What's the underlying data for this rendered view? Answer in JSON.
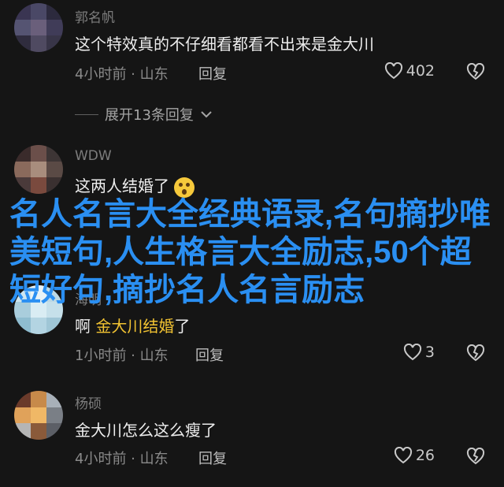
{
  "comments": [
    {
      "username": "郭名帆",
      "text": "这个特效真的不仔细看都看不出来是金大川",
      "time_location": "4小时前 · 山东",
      "reply_label": "回复",
      "likes": "402"
    },
    {
      "username": "WDW",
      "text": "这两人结婚了"
    },
    {
      "username": "海明",
      "text_prefix": "啊 ",
      "mention": "金大川结婚",
      "text_suffix": "了",
      "time_location": "1小时前 · 山东",
      "reply_label": "回复",
      "likes": "3"
    },
    {
      "username": "杨硕",
      "text": "金大川怎么这么瘦了",
      "time_location": "4小时前 · 山东",
      "reply_label": "回复",
      "likes": "26"
    }
  ],
  "expand_replies": "展开13条回复",
  "overlay_title": "名人名言大全经典语录,名句摘抄唯美短句,人生格言大全励志,50个超短好句,摘抄名人名言励志",
  "icons": {
    "like": "heart-outline-icon",
    "dislike": "broken-heart-icon",
    "expand": "chevron-down-icon"
  },
  "colors": {
    "background": "#151515",
    "overlay_text": "#2a8ff2",
    "mention": "#f1c232"
  }
}
